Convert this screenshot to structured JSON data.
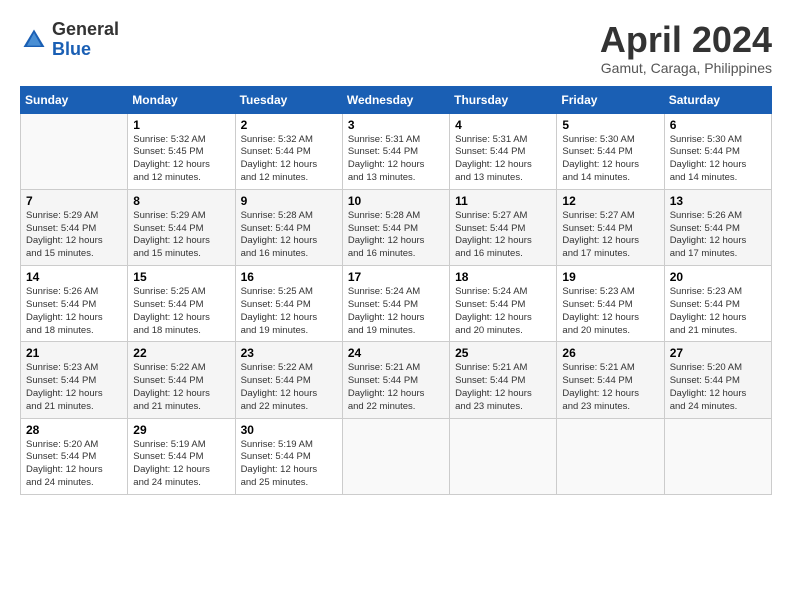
{
  "header": {
    "logo_general": "General",
    "logo_blue": "Blue",
    "month_title": "April 2024",
    "subtitle": "Gamut, Caraga, Philippines"
  },
  "calendar": {
    "days_of_week": [
      "Sunday",
      "Monday",
      "Tuesday",
      "Wednesday",
      "Thursday",
      "Friday",
      "Saturday"
    ],
    "weeks": [
      [
        {
          "num": "",
          "info": ""
        },
        {
          "num": "1",
          "info": "Sunrise: 5:32 AM\nSunset: 5:45 PM\nDaylight: 12 hours\nand 12 minutes."
        },
        {
          "num": "2",
          "info": "Sunrise: 5:32 AM\nSunset: 5:44 PM\nDaylight: 12 hours\nand 12 minutes."
        },
        {
          "num": "3",
          "info": "Sunrise: 5:31 AM\nSunset: 5:44 PM\nDaylight: 12 hours\nand 13 minutes."
        },
        {
          "num": "4",
          "info": "Sunrise: 5:31 AM\nSunset: 5:44 PM\nDaylight: 12 hours\nand 13 minutes."
        },
        {
          "num": "5",
          "info": "Sunrise: 5:30 AM\nSunset: 5:44 PM\nDaylight: 12 hours\nand 14 minutes."
        },
        {
          "num": "6",
          "info": "Sunrise: 5:30 AM\nSunset: 5:44 PM\nDaylight: 12 hours\nand 14 minutes."
        }
      ],
      [
        {
          "num": "7",
          "info": "Sunrise: 5:29 AM\nSunset: 5:44 PM\nDaylight: 12 hours\nand 15 minutes."
        },
        {
          "num": "8",
          "info": "Sunrise: 5:29 AM\nSunset: 5:44 PM\nDaylight: 12 hours\nand 15 minutes."
        },
        {
          "num": "9",
          "info": "Sunrise: 5:28 AM\nSunset: 5:44 PM\nDaylight: 12 hours\nand 16 minutes."
        },
        {
          "num": "10",
          "info": "Sunrise: 5:28 AM\nSunset: 5:44 PM\nDaylight: 12 hours\nand 16 minutes."
        },
        {
          "num": "11",
          "info": "Sunrise: 5:27 AM\nSunset: 5:44 PM\nDaylight: 12 hours\nand 16 minutes."
        },
        {
          "num": "12",
          "info": "Sunrise: 5:27 AM\nSunset: 5:44 PM\nDaylight: 12 hours\nand 17 minutes."
        },
        {
          "num": "13",
          "info": "Sunrise: 5:26 AM\nSunset: 5:44 PM\nDaylight: 12 hours\nand 17 minutes."
        }
      ],
      [
        {
          "num": "14",
          "info": "Sunrise: 5:26 AM\nSunset: 5:44 PM\nDaylight: 12 hours\nand 18 minutes."
        },
        {
          "num": "15",
          "info": "Sunrise: 5:25 AM\nSunset: 5:44 PM\nDaylight: 12 hours\nand 18 minutes."
        },
        {
          "num": "16",
          "info": "Sunrise: 5:25 AM\nSunset: 5:44 PM\nDaylight: 12 hours\nand 19 minutes."
        },
        {
          "num": "17",
          "info": "Sunrise: 5:24 AM\nSunset: 5:44 PM\nDaylight: 12 hours\nand 19 minutes."
        },
        {
          "num": "18",
          "info": "Sunrise: 5:24 AM\nSunset: 5:44 PM\nDaylight: 12 hours\nand 20 minutes."
        },
        {
          "num": "19",
          "info": "Sunrise: 5:23 AM\nSunset: 5:44 PM\nDaylight: 12 hours\nand 20 minutes."
        },
        {
          "num": "20",
          "info": "Sunrise: 5:23 AM\nSunset: 5:44 PM\nDaylight: 12 hours\nand 21 minutes."
        }
      ],
      [
        {
          "num": "21",
          "info": "Sunrise: 5:23 AM\nSunset: 5:44 PM\nDaylight: 12 hours\nand 21 minutes."
        },
        {
          "num": "22",
          "info": "Sunrise: 5:22 AM\nSunset: 5:44 PM\nDaylight: 12 hours\nand 21 minutes."
        },
        {
          "num": "23",
          "info": "Sunrise: 5:22 AM\nSunset: 5:44 PM\nDaylight: 12 hours\nand 22 minutes."
        },
        {
          "num": "24",
          "info": "Sunrise: 5:21 AM\nSunset: 5:44 PM\nDaylight: 12 hours\nand 22 minutes."
        },
        {
          "num": "25",
          "info": "Sunrise: 5:21 AM\nSunset: 5:44 PM\nDaylight: 12 hours\nand 23 minutes."
        },
        {
          "num": "26",
          "info": "Sunrise: 5:21 AM\nSunset: 5:44 PM\nDaylight: 12 hours\nand 23 minutes."
        },
        {
          "num": "27",
          "info": "Sunrise: 5:20 AM\nSunset: 5:44 PM\nDaylight: 12 hours\nand 24 minutes."
        }
      ],
      [
        {
          "num": "28",
          "info": "Sunrise: 5:20 AM\nSunset: 5:44 PM\nDaylight: 12 hours\nand 24 minutes."
        },
        {
          "num": "29",
          "info": "Sunrise: 5:19 AM\nSunset: 5:44 PM\nDaylight: 12 hours\nand 24 minutes."
        },
        {
          "num": "30",
          "info": "Sunrise: 5:19 AM\nSunset: 5:44 PM\nDaylight: 12 hours\nand 25 minutes."
        },
        {
          "num": "",
          "info": ""
        },
        {
          "num": "",
          "info": ""
        },
        {
          "num": "",
          "info": ""
        },
        {
          "num": "",
          "info": ""
        }
      ]
    ]
  }
}
